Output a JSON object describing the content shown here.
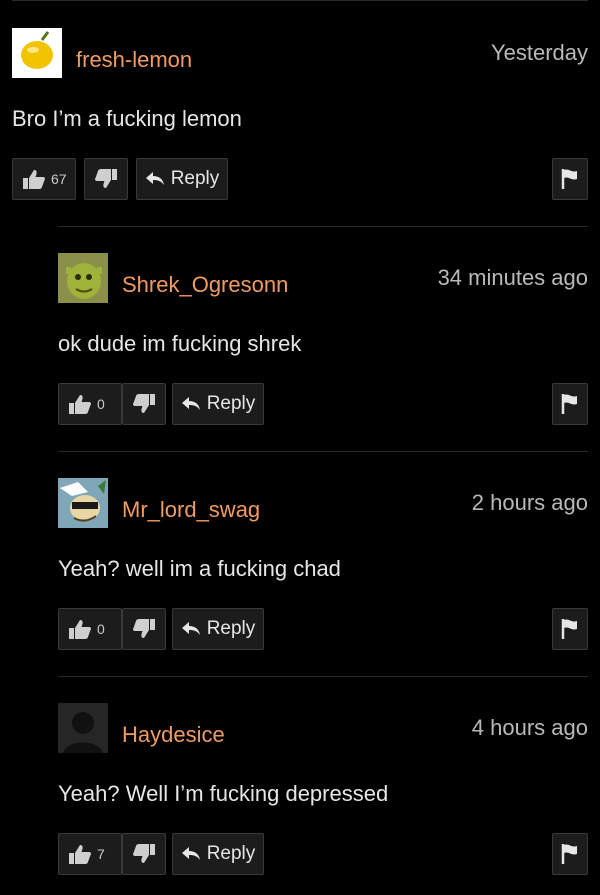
{
  "comments": [
    {
      "username": "fresh-lemon",
      "time": "Yesterday",
      "text": "Bro I’m a fucking lemon",
      "likes": "67",
      "reply_label": "Reply",
      "avatar_icon": "lemon-avatar-icon"
    },
    {
      "username": "Shrek_Ogresonn",
      "time": "34 minutes ago",
      "text": "ok dude im fucking shrek",
      "likes": "0",
      "reply_label": "Reply",
      "avatar_icon": "shrek-avatar-icon"
    },
    {
      "username": "Mr_lord_swag",
      "time": "2 hours ago",
      "text": "Yeah? well im a fucking chad",
      "likes": "0",
      "reply_label": "Reply",
      "avatar_icon": "cartoon-avatar-icon"
    },
    {
      "username": "Haydesice",
      "time": "4 hours ago",
      "text": "Yeah? Well I’m fucking depressed",
      "likes": "7",
      "reply_label": "Reply",
      "avatar_icon": "default-user-avatar-icon"
    }
  ],
  "colors": {
    "background": "#000000",
    "username": "#f29b61",
    "button_bg": "#1c1c1c",
    "button_border": "#3a3a3a",
    "divider": "#2a2a2a"
  }
}
